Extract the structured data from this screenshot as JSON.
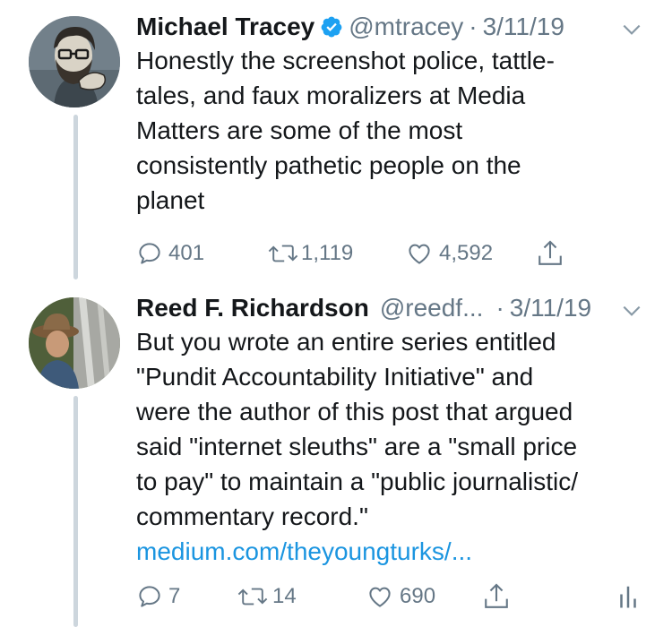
{
  "tweets": [
    {
      "author_name": "Michael Tracey",
      "verified": true,
      "handle": "@mtracey",
      "separator": "·",
      "date": "3/11/19",
      "text": "Honestly the screenshot police, tattle-tales, and faux moralizers at Media Matters are some of the most consistently pathetic people on the planet",
      "text_lines": [
        "Honestly the screenshot police, tattle-",
        "tales, and faux moralizers at Media",
        "Matters are some of the most",
        "consistently pathetic people on the",
        "planet"
      ],
      "replies": "401",
      "retweets": "1,119",
      "likes": "4,592"
    },
    {
      "author_name": "Reed F. Richardson",
      "verified": false,
      "handle": "@reedf...",
      "separator": "·",
      "date": "3/11/19",
      "text_lines": [
        "But you wrote an entire series entitled",
        "\"Pundit Accountability Initiative\" and",
        "were the author of this post that argued",
        "said \"internet sleuths\" are a \"small price",
        "to pay\" to maintain a \"public journalistic/",
        "commentary record.\""
      ],
      "link": "medium.com/theyoungturks/...",
      "replies": "7",
      "retweets": "14",
      "likes": "690"
    }
  ],
  "colors": {
    "text": "#14171a",
    "muted": "#657786",
    "link": "#1b95e0",
    "verified": "#1da1f2",
    "thread_line": "#cdd6dd"
  },
  "icons": [
    "reply-icon",
    "retweet-icon",
    "like-icon",
    "share-icon",
    "analytics-icon",
    "chevron-down-icon",
    "verified-badge-icon"
  ]
}
